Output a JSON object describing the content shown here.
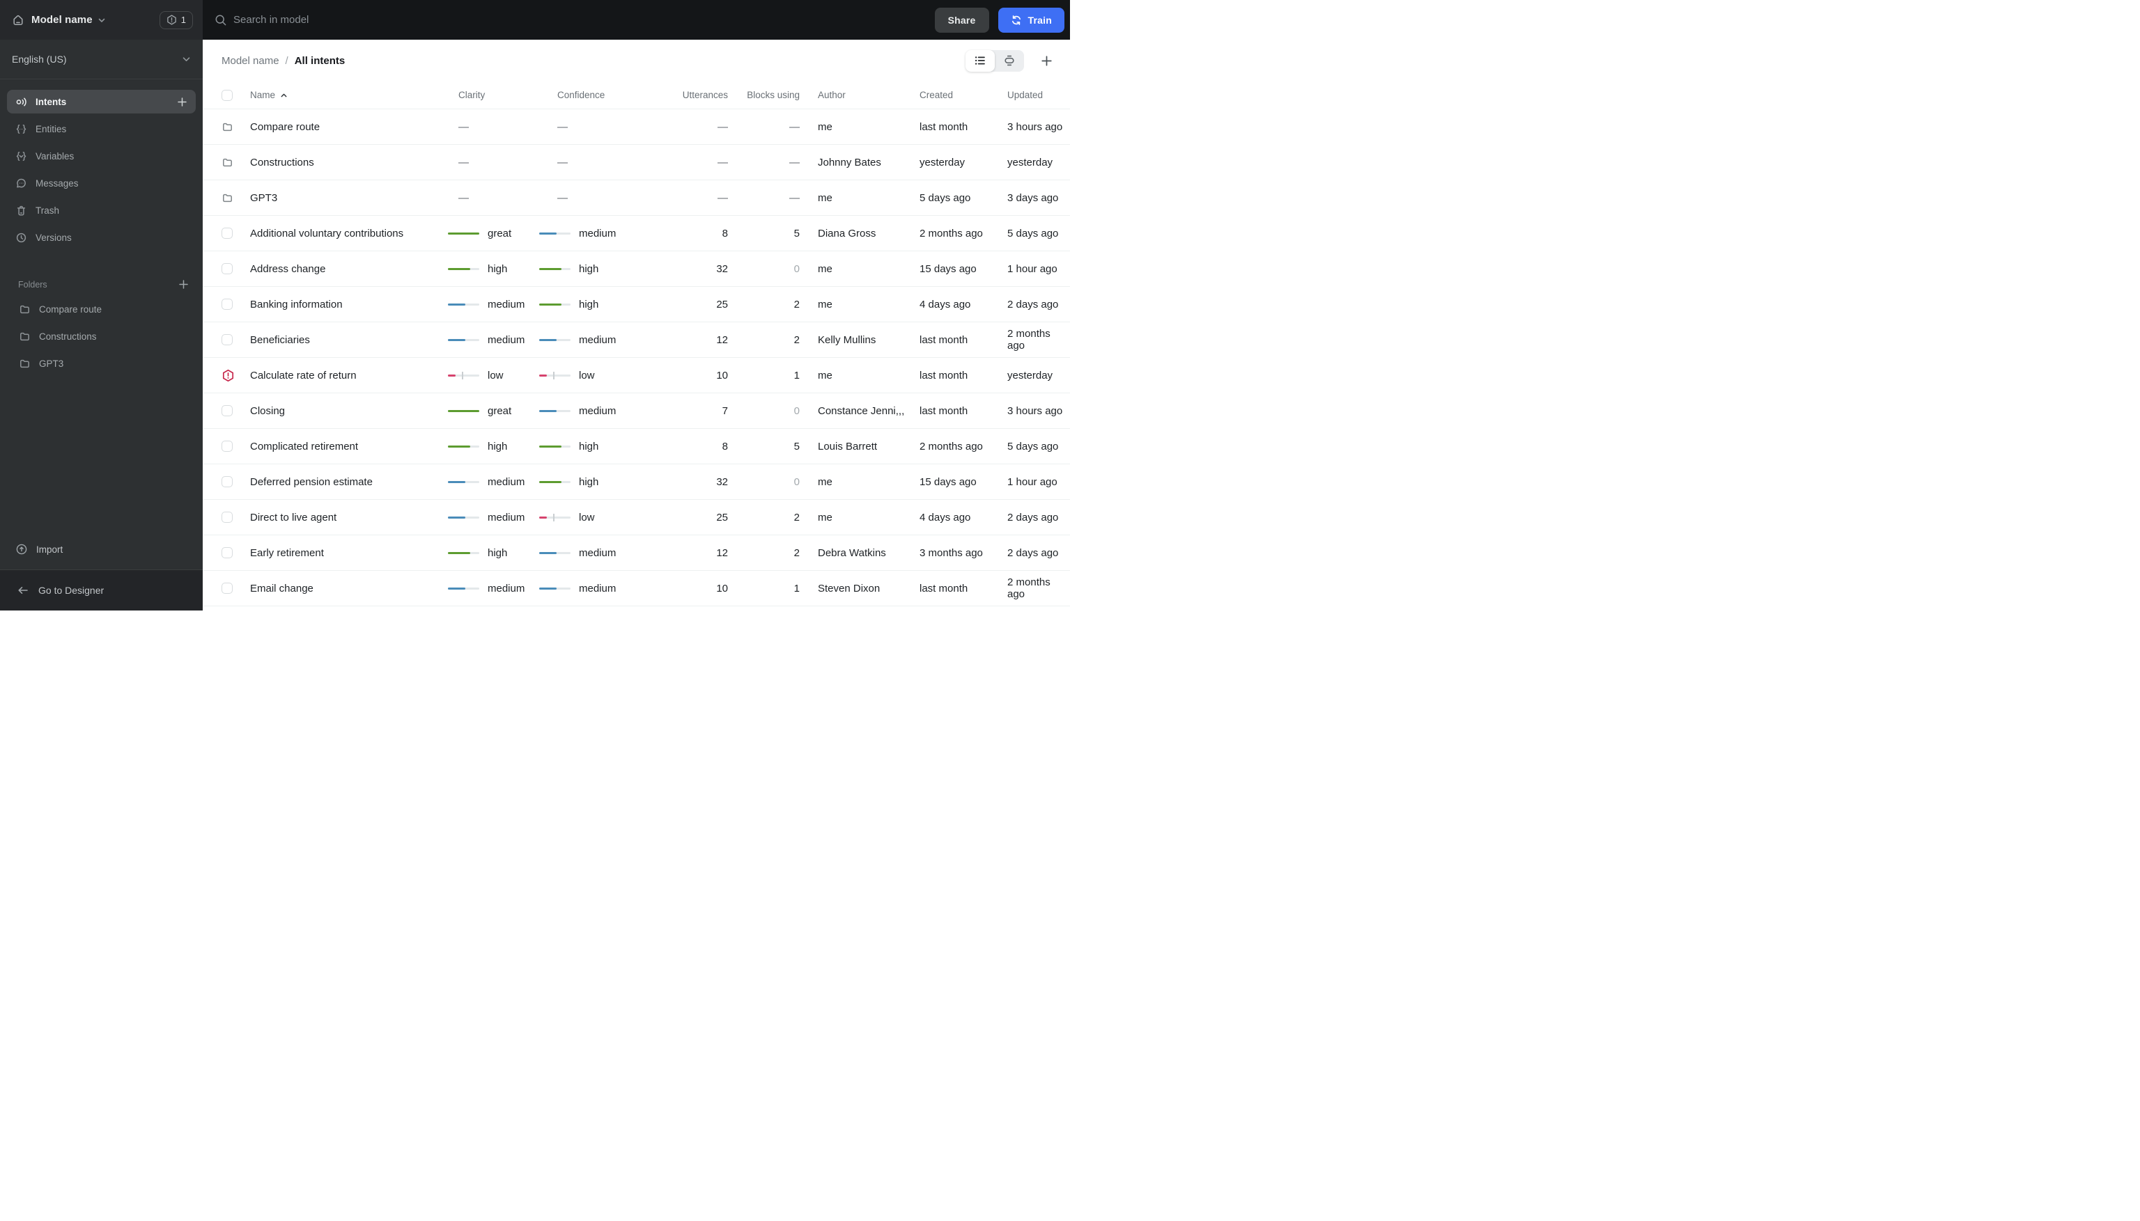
{
  "header": {
    "model_name": "Model name",
    "badge_count": "1",
    "search_placeholder": "Search in model",
    "share_label": "Share",
    "train_label": "Train"
  },
  "sidebar": {
    "language": "English (US)",
    "nav": [
      {
        "id": "intents",
        "label": "Intents",
        "icon": "intent-icon",
        "active": true,
        "action_icon": "plus-icon"
      },
      {
        "id": "entities",
        "label": "Entities",
        "icon": "entities-icon",
        "active": false
      },
      {
        "id": "variables",
        "label": "Variables",
        "icon": "variables-icon",
        "active": false
      },
      {
        "id": "messages",
        "label": "Messages",
        "icon": "messages-icon",
        "active": false
      },
      {
        "id": "trash",
        "label": "Trash",
        "icon": "trash-icon",
        "active": false
      },
      {
        "id": "versions",
        "label": "Versions",
        "icon": "versions-icon",
        "active": false
      }
    ],
    "folders_label": "Folders",
    "folders": [
      {
        "name": "Compare route"
      },
      {
        "name": "Constructions"
      },
      {
        "name": "GPT3"
      }
    ],
    "import_label": "Import",
    "designer_label": "Go to Designer"
  },
  "breadcrumb": {
    "parent": "Model name",
    "separator": "/",
    "current": "All intents"
  },
  "toolbar": {
    "views": [
      "list-view",
      "canvas-view"
    ],
    "active_view": "list-view"
  },
  "table": {
    "columns": {
      "name": "Name",
      "clarity": "Clarity",
      "confidence": "Confidence",
      "utterances": "Utterances",
      "blocks": "Blocks using",
      "author": "Author",
      "created": "Created",
      "updated": "Updated"
    },
    "sort": {
      "column": "Name",
      "direction": "asc"
    },
    "rows": [
      {
        "type": "folder",
        "warning": false,
        "name": "Compare route",
        "clarity": "—",
        "confidence": "—",
        "utterances": "—",
        "blocks": "—",
        "blocks_muted": false,
        "author": "me",
        "created": "last month",
        "updated": "3 hours ago"
      },
      {
        "type": "folder",
        "warning": false,
        "name": "Constructions",
        "clarity": "—",
        "confidence": "—",
        "utterances": "—",
        "blocks": "—",
        "blocks_muted": false,
        "author": "Johnny Bates",
        "created": "yesterday",
        "updated": "yesterday"
      },
      {
        "type": "folder",
        "warning": false,
        "name": "GPT3",
        "clarity": "—",
        "confidence": "—",
        "utterances": "—",
        "blocks": "—",
        "blocks_muted": false,
        "author": "me",
        "created": "5 days ago",
        "updated": "3 days ago"
      },
      {
        "type": "intent",
        "warning": false,
        "name": "Additional voluntary contributions",
        "clarity": "great",
        "confidence": "medium",
        "utterances": "8",
        "blocks": "5",
        "blocks_muted": false,
        "author": "Diana Gross",
        "created": "2 months ago",
        "updated": "5 days ago"
      },
      {
        "type": "intent",
        "warning": false,
        "name": "Address change",
        "clarity": "high",
        "confidence": "high",
        "utterances": "32",
        "blocks": "0",
        "blocks_muted": true,
        "author": "me",
        "created": "15 days ago",
        "updated": "1 hour ago"
      },
      {
        "type": "intent",
        "warning": false,
        "name": "Banking information",
        "clarity": "medium",
        "confidence": "high",
        "utterances": "25",
        "blocks": "2",
        "blocks_muted": false,
        "author": "me",
        "created": "4 days ago",
        "updated": "2 days ago"
      },
      {
        "type": "intent",
        "warning": false,
        "name": "Beneficiaries",
        "clarity": "medium",
        "confidence": "medium",
        "utterances": "12",
        "blocks": "2",
        "blocks_muted": false,
        "author": "Kelly Mullins",
        "created": "last month",
        "updated": "2 months ago"
      },
      {
        "type": "intent",
        "warning": true,
        "name": "Calculate rate of return",
        "clarity": "low",
        "confidence": "low",
        "utterances": "10",
        "blocks": "1",
        "blocks_muted": false,
        "author": "me",
        "created": "last month",
        "updated": "yesterday"
      },
      {
        "type": "intent",
        "warning": false,
        "name": "Closing",
        "clarity": "great",
        "confidence": "medium",
        "utterances": "7",
        "blocks": "0",
        "blocks_muted": true,
        "author": "Constance Jenni,,,",
        "created": "last month",
        "updated": "3 hours ago"
      },
      {
        "type": "intent",
        "warning": false,
        "name": "Complicated retirement",
        "clarity": "high",
        "confidence": "high",
        "utterances": "8",
        "blocks": "5",
        "blocks_muted": false,
        "author": "Louis Barrett",
        "created": "2 months ago",
        "updated": "5 days ago"
      },
      {
        "type": "intent",
        "warning": false,
        "name": "Deferred pension estimate",
        "clarity": "medium",
        "confidence": "high",
        "utterances": "32",
        "blocks": "0",
        "blocks_muted": true,
        "author": "me",
        "created": "15 days ago",
        "updated": "1 hour ago"
      },
      {
        "type": "intent",
        "warning": false,
        "name": "Direct to live agent",
        "clarity": "medium",
        "confidence": "low",
        "utterances": "25",
        "blocks": "2",
        "blocks_muted": false,
        "author": "me",
        "created": "4 days ago",
        "updated": "2 days ago"
      },
      {
        "type": "intent",
        "warning": false,
        "name": "Early retirement",
        "clarity": "high",
        "confidence": "medium",
        "utterances": "12",
        "blocks": "2",
        "blocks_muted": false,
        "author": "Debra Watkins",
        "created": "3 months ago",
        "updated": "2 days ago"
      },
      {
        "type": "intent",
        "warning": false,
        "name": "Email change",
        "clarity": "medium",
        "confidence": "medium",
        "utterances": "10",
        "blocks": "1",
        "blocks_muted": false,
        "author": "Steven Dixon",
        "created": "last month",
        "updated": "2 months ago"
      }
    ]
  },
  "colors": {
    "accent_blue": "#3E6FF4",
    "clarity_green": "#5D9C30",
    "clarity_blue": "#4A8CB9",
    "clarity_red": "#D6436D",
    "warning_red": "#C7284C",
    "indicator_track": "#E4E8EA"
  }
}
